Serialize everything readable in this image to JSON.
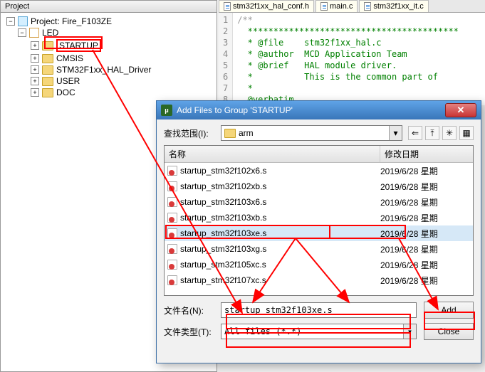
{
  "project": {
    "panel_title": "Project",
    "root_label": "Project: Fire_F103ZE",
    "target_label": "LED",
    "groups": [
      {
        "label": "STARTUP",
        "highlighted": true
      },
      {
        "label": "CMSIS"
      },
      {
        "label": "STM32F1xx_HAL_Driver"
      },
      {
        "label": "USER"
      },
      {
        "label": "DOC"
      }
    ]
  },
  "editor": {
    "tabs": [
      {
        "label": "stm32f1xx_hal_conf.h"
      },
      {
        "label": "main.c"
      },
      {
        "label": "stm32f1xx_it.c"
      }
    ],
    "lines": [
      {
        "num": "1",
        "text": "/**",
        "cls": "c-gray"
      },
      {
        "num": "2",
        "text": "  *****************************************",
        "cls": "c-green"
      },
      {
        "num": "3",
        "text": "  * @file    stm32f1xx_hal.c",
        "cls": "c-green"
      },
      {
        "num": "4",
        "text": "  * @author  MCD Application Team",
        "cls": "c-green"
      },
      {
        "num": "5",
        "text": "  * @brief   HAL module driver.",
        "cls": "c-green"
      },
      {
        "num": "6",
        "text": "  *          This is the common part of",
        "cls": "c-green"
      },
      {
        "num": "7",
        "text": "  *",
        "cls": "c-green"
      },
      {
        "num": "8",
        "text": "  @verbatim",
        "cls": "c-green"
      }
    ]
  },
  "dialog": {
    "title": "Add Files to Group 'STARTUP'",
    "lookin_label": "查找范围(I):",
    "lookin_value": "arm",
    "columns": {
      "name": "名称",
      "date": "修改日期"
    },
    "files": [
      {
        "name": "startup_stm32f102x6.s",
        "date": "2019/6/28 星期"
      },
      {
        "name": "startup_stm32f102xb.s",
        "date": "2019/6/28 星期"
      },
      {
        "name": "startup_stm32f103x6.s",
        "date": "2019/6/28 星期"
      },
      {
        "name": "startup_stm32f103xb.s",
        "date": "2019/6/28 星期"
      },
      {
        "name": "startup_stm32f103xe.s",
        "date": "2019/6/28 星期",
        "selected": true
      },
      {
        "name": "startup_stm32f103xg.s",
        "date": "2019/6/28 星期"
      },
      {
        "name": "startup_stm32f105xc.s",
        "date": "2019/6/28 星期"
      },
      {
        "name": "startup_stm32f107xc.s",
        "date": "2019/6/28 星期"
      }
    ],
    "filename_label": "文件名(N):",
    "filename_value": "startup_stm32f103xe.s",
    "filetype_label": "文件类型(T):",
    "filetype_value": "All files (*.*)",
    "add_label": "Add",
    "close_label": "Close"
  },
  "icons": {
    "back": "⇐",
    "up": "⤒",
    "newfolder": "✳",
    "view": "▦",
    "dropdown": "▾",
    "close": "✕"
  }
}
